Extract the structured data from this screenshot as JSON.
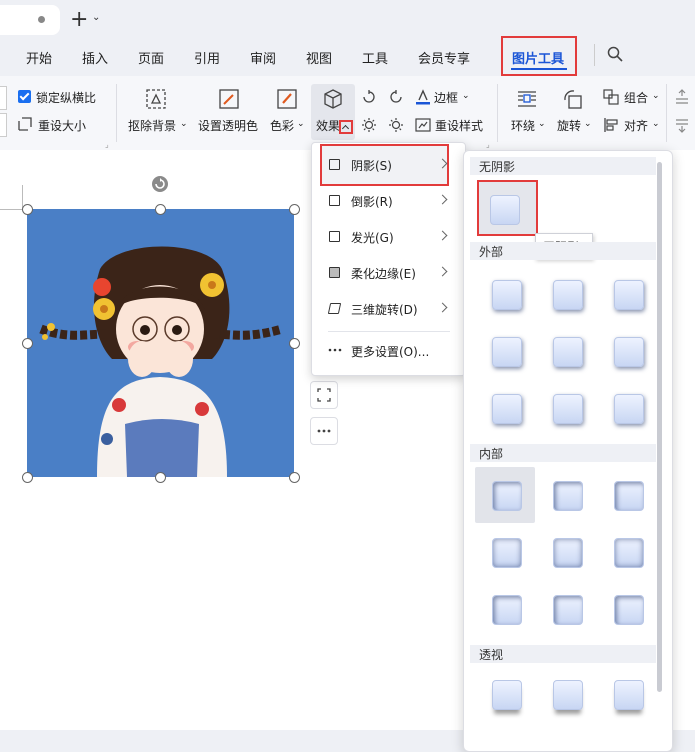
{
  "tab_bar": {
    "new_tab": "+",
    "tab_menu": "⌄"
  },
  "menu": {
    "items": [
      "开始",
      "插入",
      "页面",
      "引用",
      "审阅",
      "视图",
      "工具",
      "会员专享"
    ],
    "active": "图片工具"
  },
  "ribbon": {
    "lock_ratio": "锁定纵横比",
    "lock_ratio_checked": true,
    "reset_size": "重设大小",
    "remove_bg": "抠除背景",
    "set_transparent": "设置透明色",
    "color": "色彩",
    "effect": "效果",
    "border": "边框",
    "reset_style": "重设样式",
    "wrap": "环绕",
    "rotate": "旋转",
    "group": "组合",
    "align": "对齐"
  },
  "effect_menu": {
    "items": [
      {
        "label": "阴影(S)",
        "has_submenu": true
      },
      {
        "label": "倒影(R)",
        "has_submenu": true
      },
      {
        "label": "发光(G)",
        "has_submenu": true
      },
      {
        "label": "柔化边缘(E)",
        "has_submenu": true
      },
      {
        "label": "三维旋转(D)",
        "has_submenu": true
      }
    ],
    "more": "更多设置(O)..."
  },
  "shadow_gallery": {
    "sections": {
      "none": "无阴影",
      "outer": "外部",
      "inner": "内部",
      "perspective": "透视"
    },
    "tooltip": "无阴影"
  },
  "colors": {
    "accent": "#1a55d6",
    "highlight": "#e23b3b",
    "picture_bg": "#4a7fc6"
  }
}
